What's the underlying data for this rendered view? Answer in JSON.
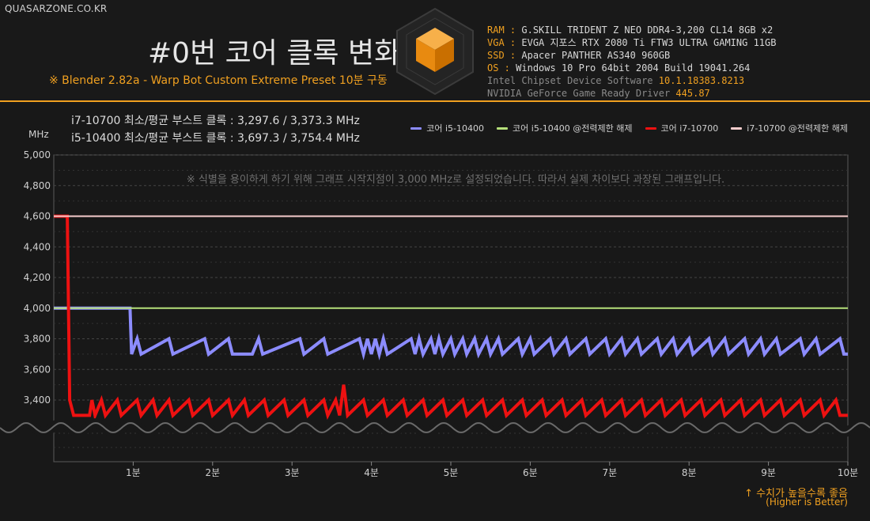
{
  "site": "QUASARZONE.CO.KR",
  "title": "#0번 코어 클록 변화",
  "subtitle": "※ Blender 2.82a - Warp Bot Custom Extreme Preset 10분 구동",
  "specs": [
    {
      "k": "RAM",
      "v": "G.SKILL TRIDENT Z NEO DDR4-3,200 CL14 8GB x2"
    },
    {
      "k": "VGA",
      "v": "EVGA 지포스 RTX 2080 Ti FTW3 ULTRA GAMING 11GB"
    },
    {
      "k": "SSD",
      "v": "Apacer PANTHER AS340 960GB"
    },
    {
      "k": "OS",
      "v": "Windows 10 Pro 64bit 2004 Build 19041.264"
    }
  ],
  "drivers": [
    {
      "k": "Intel Chipset Device Software",
      "v": "10.1.18383.8213"
    },
    {
      "k": "NVIDIA GeForce Game Ready Driver",
      "v": "445.87"
    }
  ],
  "stats": [
    "i7-10700 최소/평균 부스트 클록 : 3,297.6 / 3,373.3 MHz",
    "i5-10400 최소/평균 부스트 클록 : 3,697.3 / 3,754.4 MHz"
  ],
  "footer": {
    "line1": "↑ 수치가 높을수록 좋음",
    "line2": "(Higher is Better)"
  },
  "chart_data": {
    "type": "line",
    "ylabel": "MHz",
    "ylim": [
      3000,
      5000
    ],
    "xlim": [
      0,
      10
    ],
    "yticks": [
      3400,
      3600,
      3800,
      4000,
      4200,
      4400,
      4600,
      4800,
      5000
    ],
    "ytick_labels": [
      "3,400",
      "3,600",
      "3,800",
      "4,000",
      "4,200",
      "4,400",
      "4,600",
      "4,800",
      "5,000"
    ],
    "xticks": [
      1,
      2,
      3,
      4,
      5,
      6,
      7,
      8,
      9,
      10
    ],
    "xtick_labels": [
      "1분",
      "2분",
      "3분",
      "4분",
      "5분",
      "6분",
      "7분",
      "8분",
      "9분",
      "10분"
    ],
    "axis_break": true,
    "grid": true,
    "legend_position": "top-right",
    "annotation": "※ 식별을 용이하게 하기 위해 그래프 시작지점이 3,000 MHz로 설정되었습니다. 따라서 실제 차이보다 과장된 그래프입니다.",
    "series": [
      {
        "name": "코어 i5-10400",
        "color": "#8c8cff",
        "width": 4,
        "points": [
          [
            0,
            4000
          ],
          [
            0.96,
            4000
          ],
          [
            0.98,
            3700
          ],
          [
            1.05,
            3800
          ],
          [
            1.1,
            3700
          ],
          [
            1.45,
            3800
          ],
          [
            1.5,
            3700
          ],
          [
            1.9,
            3800
          ],
          [
            1.95,
            3700
          ],
          [
            2.2,
            3800
          ],
          [
            2.25,
            3700
          ],
          [
            2.5,
            3700
          ],
          [
            2.58,
            3800
          ],
          [
            2.63,
            3700
          ],
          [
            3.1,
            3800
          ],
          [
            3.15,
            3700
          ],
          [
            3.4,
            3800
          ],
          [
            3.45,
            3700
          ],
          [
            3.85,
            3800
          ],
          [
            3.9,
            3700
          ],
          [
            3.95,
            3800
          ],
          [
            4.0,
            3700
          ],
          [
            4.05,
            3800
          ],
          [
            4.1,
            3700
          ],
          [
            4.15,
            3800
          ],
          [
            4.2,
            3700
          ],
          [
            4.5,
            3800
          ],
          [
            4.55,
            3700
          ],
          [
            4.6,
            3800
          ],
          [
            4.65,
            3700
          ],
          [
            4.75,
            3800
          ],
          [
            4.8,
            3700
          ],
          [
            4.85,
            3800
          ],
          [
            4.9,
            3700
          ],
          [
            5.0,
            3800
          ],
          [
            5.05,
            3700
          ],
          [
            5.15,
            3800
          ],
          [
            5.2,
            3700
          ],
          [
            5.3,
            3800
          ],
          [
            5.35,
            3700
          ],
          [
            5.45,
            3800
          ],
          [
            5.5,
            3700
          ],
          [
            5.6,
            3800
          ],
          [
            5.65,
            3700
          ],
          [
            5.85,
            3800
          ],
          [
            5.9,
            3700
          ],
          [
            6.0,
            3800
          ],
          [
            6.05,
            3700
          ],
          [
            6.25,
            3800
          ],
          [
            6.3,
            3700
          ],
          [
            6.45,
            3800
          ],
          [
            6.5,
            3700
          ],
          [
            6.7,
            3800
          ],
          [
            6.75,
            3700
          ],
          [
            6.95,
            3800
          ],
          [
            7.0,
            3700
          ],
          [
            7.15,
            3800
          ],
          [
            7.2,
            3700
          ],
          [
            7.35,
            3800
          ],
          [
            7.4,
            3700
          ],
          [
            7.6,
            3800
          ],
          [
            7.65,
            3700
          ],
          [
            7.8,
            3800
          ],
          [
            7.85,
            3700
          ],
          [
            8.0,
            3800
          ],
          [
            8.05,
            3700
          ],
          [
            8.25,
            3800
          ],
          [
            8.3,
            3700
          ],
          [
            8.45,
            3800
          ],
          [
            8.5,
            3700
          ],
          [
            8.7,
            3800
          ],
          [
            8.75,
            3700
          ],
          [
            8.9,
            3800
          ],
          [
            8.95,
            3700
          ],
          [
            9.1,
            3800
          ],
          [
            9.15,
            3700
          ],
          [
            9.4,
            3800
          ],
          [
            9.45,
            3700
          ],
          [
            9.6,
            3800
          ],
          [
            9.65,
            3700
          ],
          [
            9.9,
            3800
          ],
          [
            9.95,
            3700
          ],
          [
            10,
            3700
          ]
        ]
      },
      {
        "name": "코어 i5-10400 @전력제한 해제",
        "color": "#b5e07a",
        "width": 2,
        "points": [
          [
            0,
            4000
          ],
          [
            10,
            4000
          ]
        ]
      },
      {
        "name": "코어 i7-10700",
        "color": "#ee1111",
        "width": 4,
        "points": [
          [
            0,
            4600
          ],
          [
            0.17,
            4600
          ],
          [
            0.2,
            3400
          ],
          [
            0.25,
            3300
          ],
          [
            0.45,
            3300
          ],
          [
            0.48,
            3400
          ],
          [
            0.52,
            3300
          ],
          [
            0.6,
            3400
          ],
          [
            0.65,
            3300
          ],
          [
            0.8,
            3400
          ],
          [
            0.85,
            3300
          ],
          [
            1.05,
            3400
          ],
          [
            1.1,
            3300
          ],
          [
            1.25,
            3400
          ],
          [
            1.3,
            3300
          ],
          [
            1.45,
            3400
          ],
          [
            1.5,
            3300
          ],
          [
            1.7,
            3400
          ],
          [
            1.75,
            3300
          ],
          [
            1.95,
            3400
          ],
          [
            2.0,
            3300
          ],
          [
            2.2,
            3400
          ],
          [
            2.25,
            3300
          ],
          [
            2.4,
            3400
          ],
          [
            2.45,
            3300
          ],
          [
            2.65,
            3400
          ],
          [
            2.7,
            3300
          ],
          [
            2.9,
            3400
          ],
          [
            2.95,
            3300
          ],
          [
            3.15,
            3400
          ],
          [
            3.2,
            3300
          ],
          [
            3.4,
            3400
          ],
          [
            3.45,
            3300
          ],
          [
            3.55,
            3400
          ],
          [
            3.6,
            3300
          ],
          [
            3.65,
            3500
          ],
          [
            3.7,
            3300
          ],
          [
            3.9,
            3400
          ],
          [
            3.95,
            3300
          ],
          [
            4.15,
            3400
          ],
          [
            4.2,
            3300
          ],
          [
            4.4,
            3400
          ],
          [
            4.45,
            3300
          ],
          [
            4.65,
            3400
          ],
          [
            4.7,
            3300
          ],
          [
            4.9,
            3400
          ],
          [
            4.95,
            3300
          ],
          [
            5.15,
            3400
          ],
          [
            5.2,
            3300
          ],
          [
            5.4,
            3400
          ],
          [
            5.45,
            3300
          ],
          [
            5.65,
            3400
          ],
          [
            5.7,
            3300
          ],
          [
            5.9,
            3400
          ],
          [
            5.95,
            3300
          ],
          [
            6.15,
            3400
          ],
          [
            6.2,
            3300
          ],
          [
            6.4,
            3400
          ],
          [
            6.45,
            3300
          ],
          [
            6.65,
            3400
          ],
          [
            6.7,
            3300
          ],
          [
            6.9,
            3400
          ],
          [
            6.95,
            3300
          ],
          [
            7.15,
            3400
          ],
          [
            7.2,
            3300
          ],
          [
            7.4,
            3400
          ],
          [
            7.45,
            3300
          ],
          [
            7.65,
            3400
          ],
          [
            7.7,
            3300
          ],
          [
            7.9,
            3400
          ],
          [
            7.95,
            3300
          ],
          [
            8.15,
            3400
          ],
          [
            8.2,
            3300
          ],
          [
            8.4,
            3400
          ],
          [
            8.45,
            3300
          ],
          [
            8.65,
            3400
          ],
          [
            8.7,
            3300
          ],
          [
            8.9,
            3400
          ],
          [
            8.95,
            3300
          ],
          [
            9.15,
            3400
          ],
          [
            9.2,
            3300
          ],
          [
            9.4,
            3400
          ],
          [
            9.45,
            3300
          ],
          [
            9.65,
            3400
          ],
          [
            9.7,
            3300
          ],
          [
            9.85,
            3400
          ],
          [
            9.9,
            3300
          ],
          [
            10,
            3300
          ]
        ]
      },
      {
        "name": "i7-10700 @전력제한 해제",
        "color": "#f6cccc",
        "width": 2,
        "points": [
          [
            0,
            4600
          ],
          [
            10,
            4600
          ]
        ]
      }
    ]
  }
}
